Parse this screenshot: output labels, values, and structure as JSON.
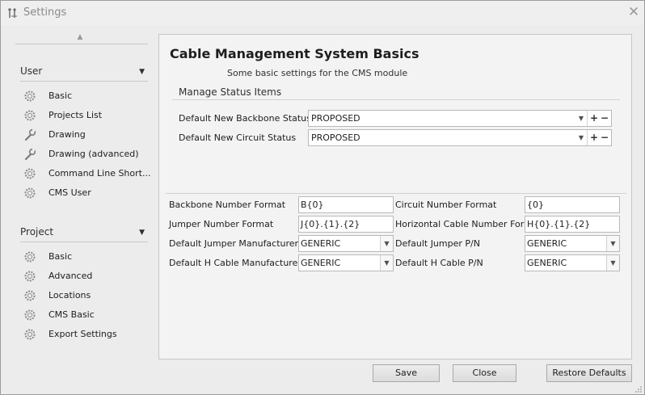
{
  "window": {
    "title": "Settings"
  },
  "sidebar": {
    "groups": [
      {
        "title": "User",
        "items": [
          {
            "label": "Basic",
            "icon": "gear-icon"
          },
          {
            "label": "Projects List",
            "icon": "gear-icon"
          },
          {
            "label": "Drawing",
            "icon": "wrench-icon"
          },
          {
            "label": "Drawing (advanced)",
            "icon": "wrench-icon"
          },
          {
            "label": "Command Line Short...",
            "icon": "gear-icon"
          },
          {
            "label": "CMS User",
            "icon": "gear-icon"
          }
        ]
      },
      {
        "title": "Project",
        "items": [
          {
            "label": "Basic",
            "icon": "gear-icon"
          },
          {
            "label": "Advanced",
            "icon": "gear-icon"
          },
          {
            "label": "Locations",
            "icon": "gear-icon"
          },
          {
            "label": "CMS Basic",
            "icon": "gear-icon"
          },
          {
            "label": "Export Settings",
            "icon": "gear-icon"
          }
        ]
      }
    ]
  },
  "panel": {
    "title": "Cable Management System Basics",
    "subtitle": "Some basic settings for the CMS module",
    "section_title": "Manage Status Items",
    "status_fields": [
      {
        "label": "Default New Backbone Status",
        "value": "PROPOSED"
      },
      {
        "label": "Default New Circuit Status",
        "value": "PROPOSED"
      }
    ],
    "formats": {
      "backbone_label": "Backbone Number Format",
      "backbone_value": "B{0}",
      "circuit_label": "Circuit Number Format",
      "circuit_value": "{0}",
      "jumper_label": "Jumper Number Format",
      "jumper_value": "J{0}.{1}.{2}",
      "hcable_label": "Horizontal Cable Number Format",
      "hcable_value": "H{0}.{1}.{2}",
      "jumper_mfr_label": "Default Jumper Manufacturer",
      "jumper_mfr_value": "GENERIC",
      "jumper_pn_label": "Default Jumper P/N",
      "jumper_pn_value": "GENERIC",
      "hcable_mfr_label": "Default H Cable Manufacturer",
      "hcable_mfr_value": "GENERIC",
      "hcable_pn_label": "Default H Cable P/N",
      "hcable_pn_value": "GENERIC"
    }
  },
  "buttons": {
    "save": "Save",
    "close": "Close",
    "restore": "Restore Defaults"
  }
}
